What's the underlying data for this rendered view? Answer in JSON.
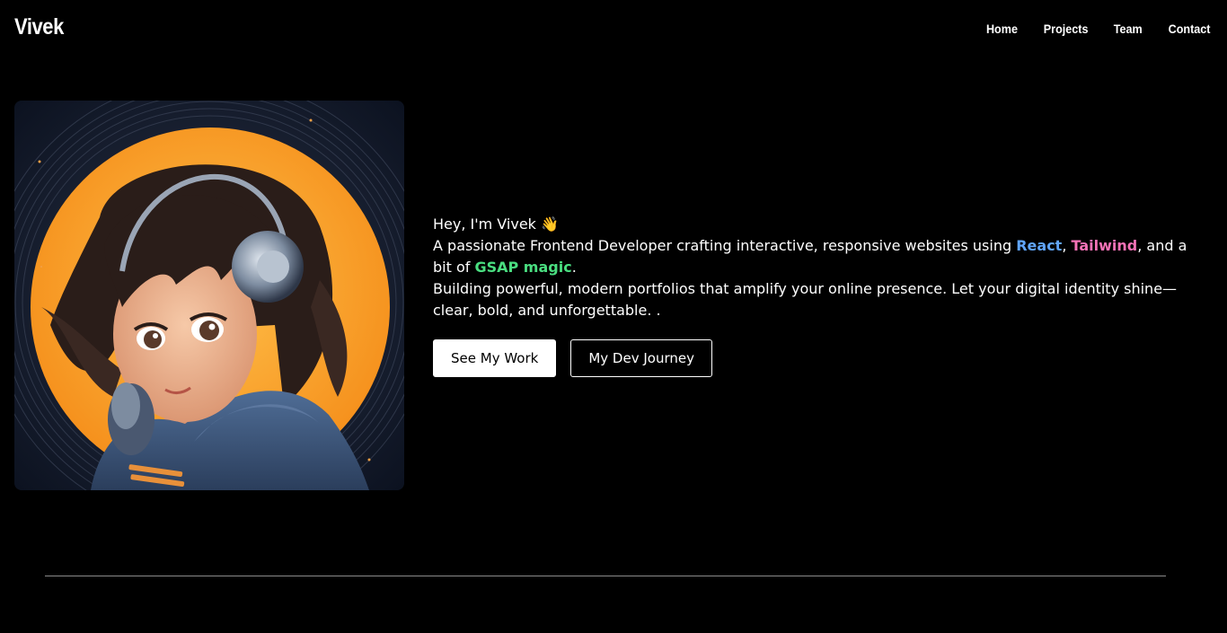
{
  "brand": "Vivek",
  "nav": {
    "items": [
      "Home",
      "Projects",
      "Team",
      "Contact"
    ]
  },
  "hero": {
    "image_alt": "Anime girl with headphones in front of an orange vinyl record",
    "greeting": "Hey, I'm Vivek 👋",
    "line1_prefix": "A passionate Frontend Developer crafting interactive, responsive websites using ",
    "tech_react": "React",
    "sep1": ", ",
    "tech_tailwind": "Tailwind",
    "sep2": ", and a bit of ",
    "tech_gsap": "GSAP magic",
    "line1_suffix": ".",
    "line2": "Building powerful, modern portfolios that amplify your online presence. Let your digital identity shine—clear, bold, and unforgettable. ."
  },
  "buttons": {
    "primary": "See My Work",
    "secondary": "My Dev Journey"
  },
  "colors": {
    "background": "#000000",
    "react": "#60a5fa",
    "tailwind": "#f472b6",
    "gsap": "#4ade80"
  }
}
